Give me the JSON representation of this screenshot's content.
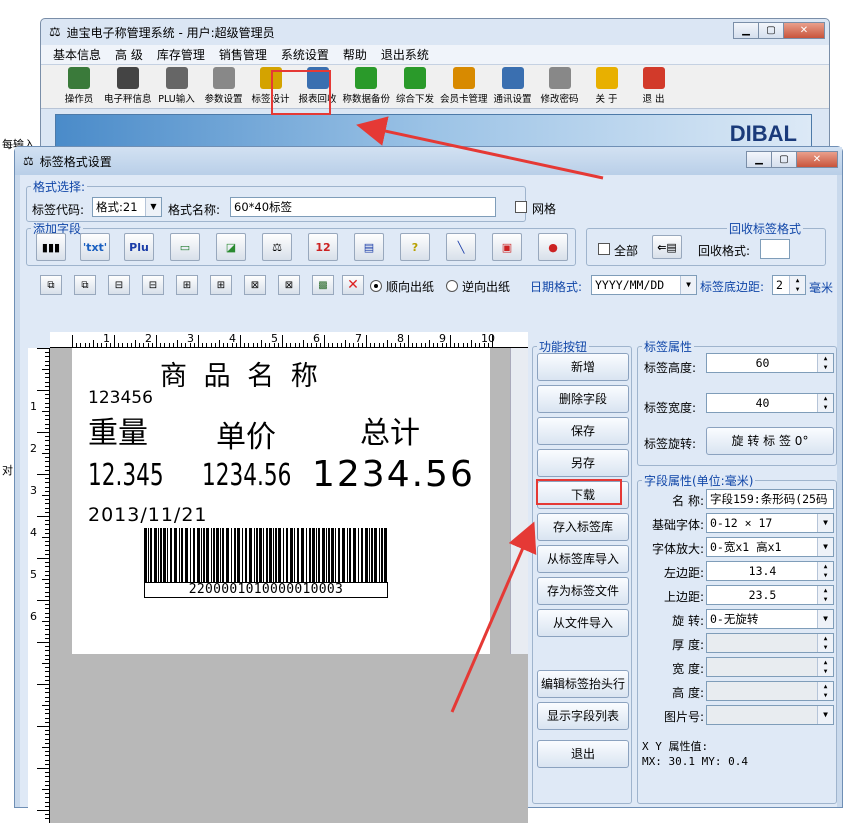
{
  "main_window": {
    "title": "迪宝电子称管理系统 - 用户:超级管理员",
    "menu": [
      "基本信息",
      "高 级",
      "库存管理",
      "销售管理",
      "系统设置",
      "帮助",
      "退出系统"
    ],
    "toolbar": [
      "操作员",
      "电子秤信息",
      "PLU输入",
      "参数设置",
      "标签设计",
      "报表回收",
      "称数据备份",
      "综合下发",
      "会员卡管理",
      "通讯设置",
      "修改密码",
      "关 于",
      "退 出"
    ],
    "brand": "DIBAL"
  },
  "side_fragments": [
    "每输入",
    "对"
  ],
  "dialog": {
    "title": "标签格式设置",
    "format_select": {
      "legend": "格式选择:",
      "code_label": "标签代码:",
      "code_value": "格式:21",
      "name_label": "格式名称:",
      "name_value": "60*40标签",
      "grid_label": "网格"
    },
    "add_field": {
      "legend": "添加字段",
      "plu_label": "Plu",
      "box12_label": "12"
    },
    "recycle": {
      "legend": "回收标签格式",
      "all_label": "全部",
      "format_label": "回收格式:"
    },
    "direction": {
      "forward": "顺向出纸",
      "reverse": "逆向出纸"
    },
    "date_format": {
      "label": "日期格式:",
      "value": "YYYY/MM/DD"
    },
    "bottom_margin": {
      "label": "标签底边距:",
      "value": "2",
      "unit": "毫米"
    },
    "ruler": {
      "h": [
        "1",
        "2",
        "3",
        "4",
        "5",
        "6",
        "7",
        "8",
        "9",
        "10"
      ],
      "v": [
        "1",
        "2",
        "3",
        "4",
        "5",
        "6"
      ]
    },
    "label_preview": {
      "product_name": "商 品 名 称",
      "code": "123456",
      "weight_title": "重量",
      "price_title": "单价",
      "total_title": "总计",
      "weight": "12.345",
      "price": "1234.56",
      "total": "1234.56",
      "date": "2013/11/21",
      "barcode_number": "2200001010000010003"
    },
    "func_buttons": {
      "legend": "功能按钮",
      "items": [
        "新增",
        "删除字段",
        "保存",
        "另存",
        "下载",
        "存入标签库",
        "从标签库导入",
        "存为标签文件",
        "从文件导入",
        "编辑标签抬头行",
        "显示字段列表",
        "退出"
      ]
    },
    "label_props": {
      "legend": "标签属性",
      "height_label": "标签高度:",
      "height_value": "60",
      "width_label": "标签宽度:",
      "width_value": "40",
      "rotate_label": "标签旋转:",
      "rotate_value": "旋 转 标 签 0°"
    },
    "field_props": {
      "legend": "字段属性(单位:毫米)",
      "name_label": "名  称:",
      "name_value": "字段159:条形码(25码",
      "font_label": "基础字体:",
      "font_value": "0-12 × 17",
      "zoom_label": "字体放大:",
      "zoom_value": "0-宽x1 高x1",
      "left_label": "左边距:",
      "left_value": "13.4",
      "top_label": "上边距:",
      "top_value": "23.5",
      "rotate_label": "旋  转:",
      "rotate_value": "0-无旋转",
      "thick_label": "厚  度:",
      "width_label": "宽  度:",
      "height_label": "高  度:",
      "pic_label": "图片号:",
      "xy_label": "X  Y 属性值:",
      "xy_value": "MX: 30.1 MY:  0.4"
    }
  },
  "colors": {
    "highlight": "#e53935",
    "link_blue": "#1046a8",
    "dialog_bg": "#dfe9f6"
  }
}
